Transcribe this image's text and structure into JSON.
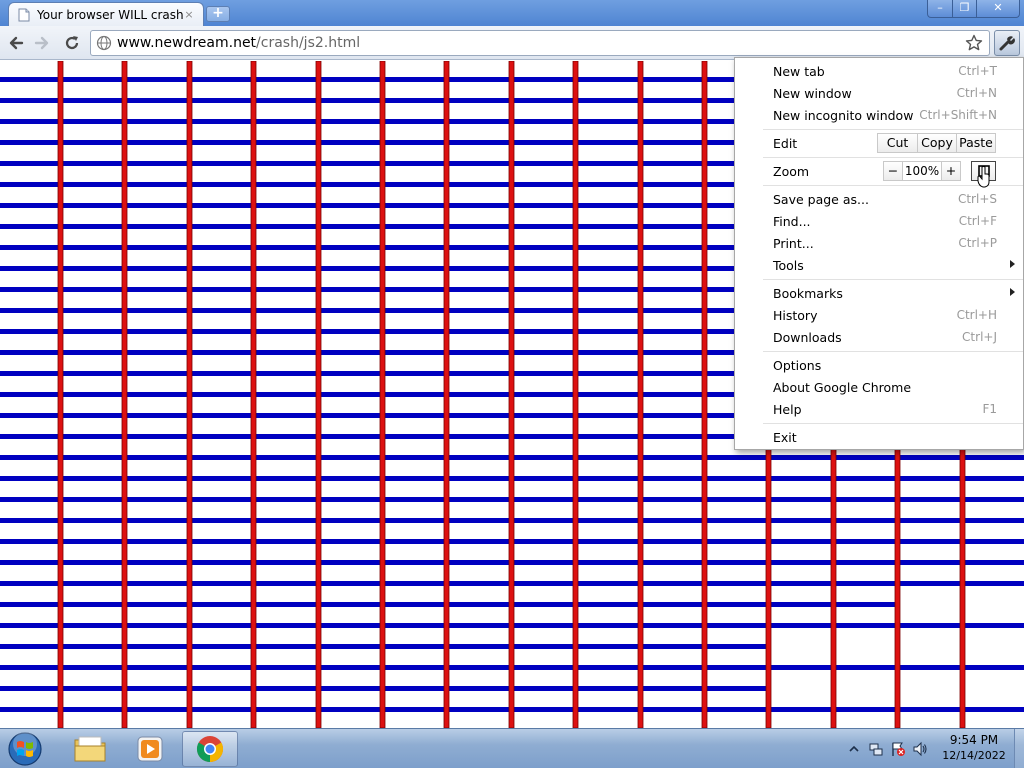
{
  "window": {
    "tab_title": "Your browser WILL crash",
    "tab_close_glyph": "×",
    "new_tab_glyph": "+",
    "minimize_glyph": "–",
    "maximize_glyph": "❐",
    "close_glyph": "✕"
  },
  "toolbar": {
    "url_host": "www.newdream.net",
    "url_path": "/crash/js2.html"
  },
  "page": {
    "line_colors": {
      "horizontal": "#0000c0",
      "vertical": "#dd1111"
    }
  },
  "menu": {
    "new_tab": {
      "label": "New tab",
      "shortcut": "Ctrl+T"
    },
    "new_window": {
      "label": "New window",
      "shortcut": "Ctrl+N"
    },
    "new_incognito": {
      "label": "New incognito window",
      "shortcut": "Ctrl+Shift+N"
    },
    "edit": {
      "label": "Edit",
      "cut": "Cut",
      "copy": "Copy",
      "paste": "Paste"
    },
    "zoom": {
      "label": "Zoom",
      "minus": "−",
      "value": "100%",
      "plus": "+"
    },
    "save_page": {
      "label": "Save page as...",
      "shortcut": "Ctrl+S"
    },
    "find": {
      "label": "Find...",
      "shortcut": "Ctrl+F"
    },
    "print": {
      "label": "Print...",
      "shortcut": "Ctrl+P"
    },
    "tools": {
      "label": "Tools"
    },
    "bookmarks": {
      "label": "Bookmarks"
    },
    "history": {
      "label": "History",
      "shortcut": "Ctrl+H"
    },
    "downloads": {
      "label": "Downloads",
      "shortcut": "Ctrl+J"
    },
    "options": {
      "label": "Options"
    },
    "about": {
      "label": "About Google Chrome"
    },
    "help": {
      "label": "Help",
      "shortcut": "F1"
    },
    "exit": {
      "label": "Exit"
    }
  },
  "taskbar": {
    "time": "9:54 PM",
    "date": "12/14/2022"
  }
}
